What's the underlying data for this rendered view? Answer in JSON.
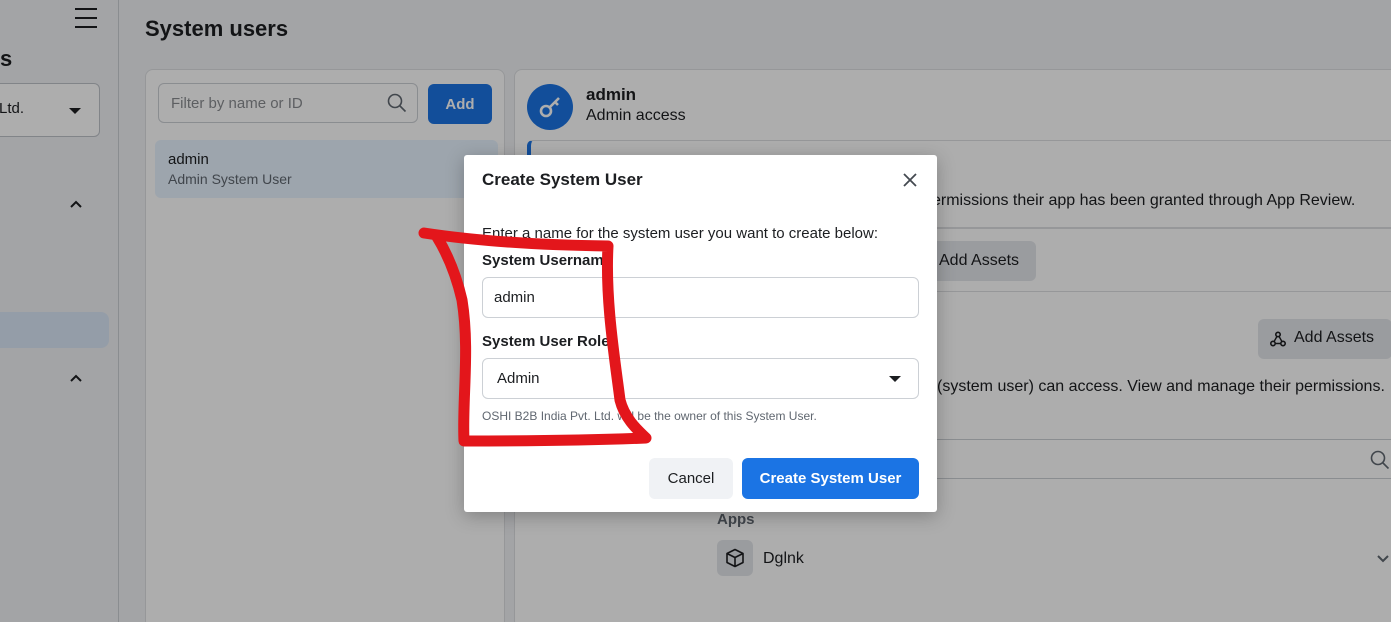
{
  "sidebar": {
    "title": "s",
    "business_select": "Ltd."
  },
  "page": {
    "title": "System users"
  },
  "user_list": {
    "filter_placeholder": "Filter by name or ID",
    "add_label": "Add",
    "users": [
      {
        "name": "admin",
        "role": "Admin System User"
      }
    ]
  },
  "detail": {
    "name": "admin",
    "access": "Admin access",
    "notice_text": "ermissions their app has been granted through App Review.",
    "add_assets_label": "Add Assets",
    "add_assets_label_2": "Add Assets",
    "assets_text": "(system user) can access. View and manage their permissions.",
    "apps_heading": "Apps",
    "apps": [
      {
        "name": "Dglnk"
      }
    ]
  },
  "modal": {
    "title": "Create System User",
    "intro": "Enter a name for the system user you want to create below:",
    "username_label": "System Usernam",
    "username_value": "admin",
    "role_label": "System User Role",
    "role_value": "Admin",
    "owner_note": "OSHI B2B India Pvt. Ltd. will be the owner of this System User.",
    "cancel_label": "Cancel",
    "create_label": "Create System User"
  },
  "colors": {
    "accent": "#1b74e4",
    "annotation": "#e3161b"
  }
}
